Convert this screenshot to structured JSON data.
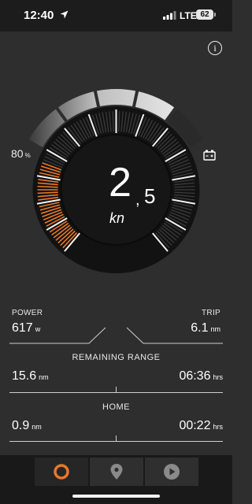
{
  "status_bar": {
    "time": "12:40",
    "carrier": "LTE",
    "battery": "62"
  },
  "gauge": {
    "speed_integer": "2",
    "speed_separator": ",",
    "speed_decimal": "5",
    "speed_unit": "kn",
    "battery_percent": "80",
    "battery_percent_unit": "%",
    "speed_fraction": 0.25,
    "battery_fraction": 0.8
  },
  "stats": {
    "power_label": "POWER",
    "power_value": "617",
    "power_unit": "w",
    "trip_label": "TRIP",
    "trip_value": "6.1",
    "trip_unit": "nm"
  },
  "remaining_range": {
    "title": "REMAINING RANGE",
    "distance": "15.6",
    "distance_unit": "nm",
    "time": "06:36",
    "time_unit": "hrs"
  },
  "home": {
    "title": "HOME",
    "distance": "0.9",
    "distance_unit": "nm",
    "time": "00:22",
    "time_unit": "hrs"
  },
  "tabs": [
    {
      "icon": "speedometer-ring-icon",
      "active": true
    },
    {
      "icon": "location-pin-icon",
      "active": false
    },
    {
      "icon": "play-icon",
      "active": false
    }
  ],
  "colors": {
    "accent": "#e8782a",
    "background": "#2e2e2e",
    "tab_bar": "#191919"
  }
}
